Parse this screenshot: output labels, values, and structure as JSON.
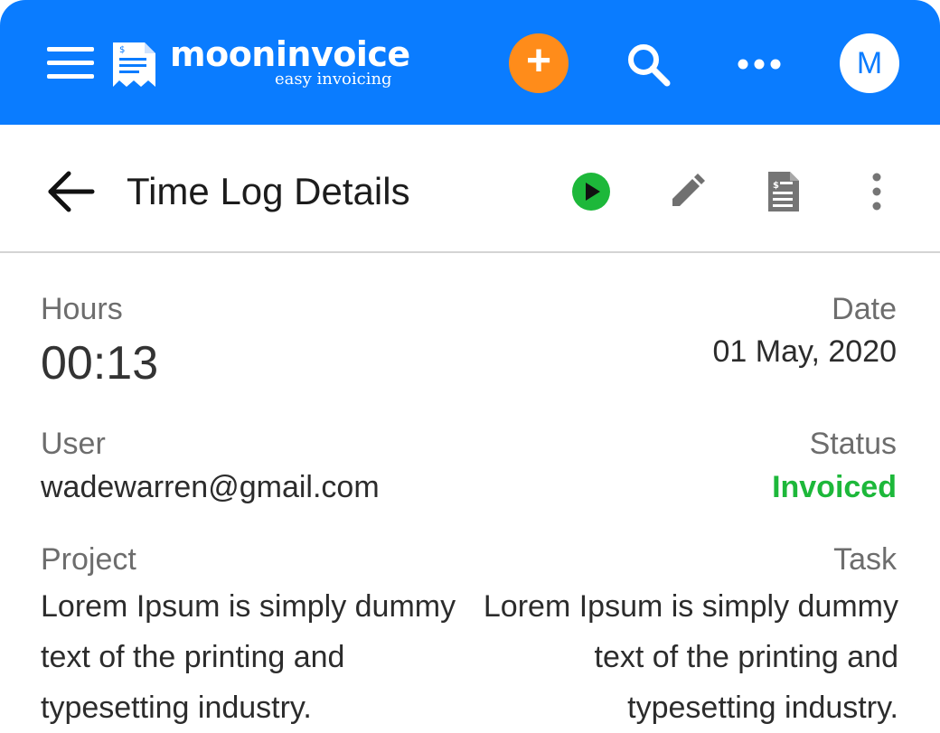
{
  "app": {
    "brand": "mooninvoice",
    "tagline": "easy invoicing",
    "add_label": "+",
    "avatar_initial": "M"
  },
  "toolbar": {
    "title": "Time Log Details"
  },
  "details": {
    "hours_label": "Hours",
    "hours_value": "00:13",
    "date_label": "Date",
    "date_value": "01 May, 2020",
    "user_label": "User",
    "user_value": "wadewarren@gmail.com",
    "status_label": "Status",
    "status_value": "Invoiced",
    "project_label": "Project",
    "project_value": "Lorem Ipsum is simply dummy text of the printing and typesetting industry.",
    "task_label": "Task",
    "task_value": "Lorem Ipsum is simply dummy text of the printing and typesetting industry."
  },
  "icons": {
    "menu": "hamburger-menu-icon",
    "logo": "invoice-logo-icon",
    "search": "search-icon",
    "more": "more-horizontal-icon",
    "back": "arrow-left-icon",
    "play": "play-circle-icon",
    "edit": "pencil-icon",
    "invoice": "invoice-document-icon",
    "kebab": "more-vertical-icon"
  },
  "colors": {
    "appbar": "#0a7cff",
    "add_button": "#ff8c1a",
    "status_invoiced": "#1db83a",
    "play_green": "#1db83a"
  }
}
